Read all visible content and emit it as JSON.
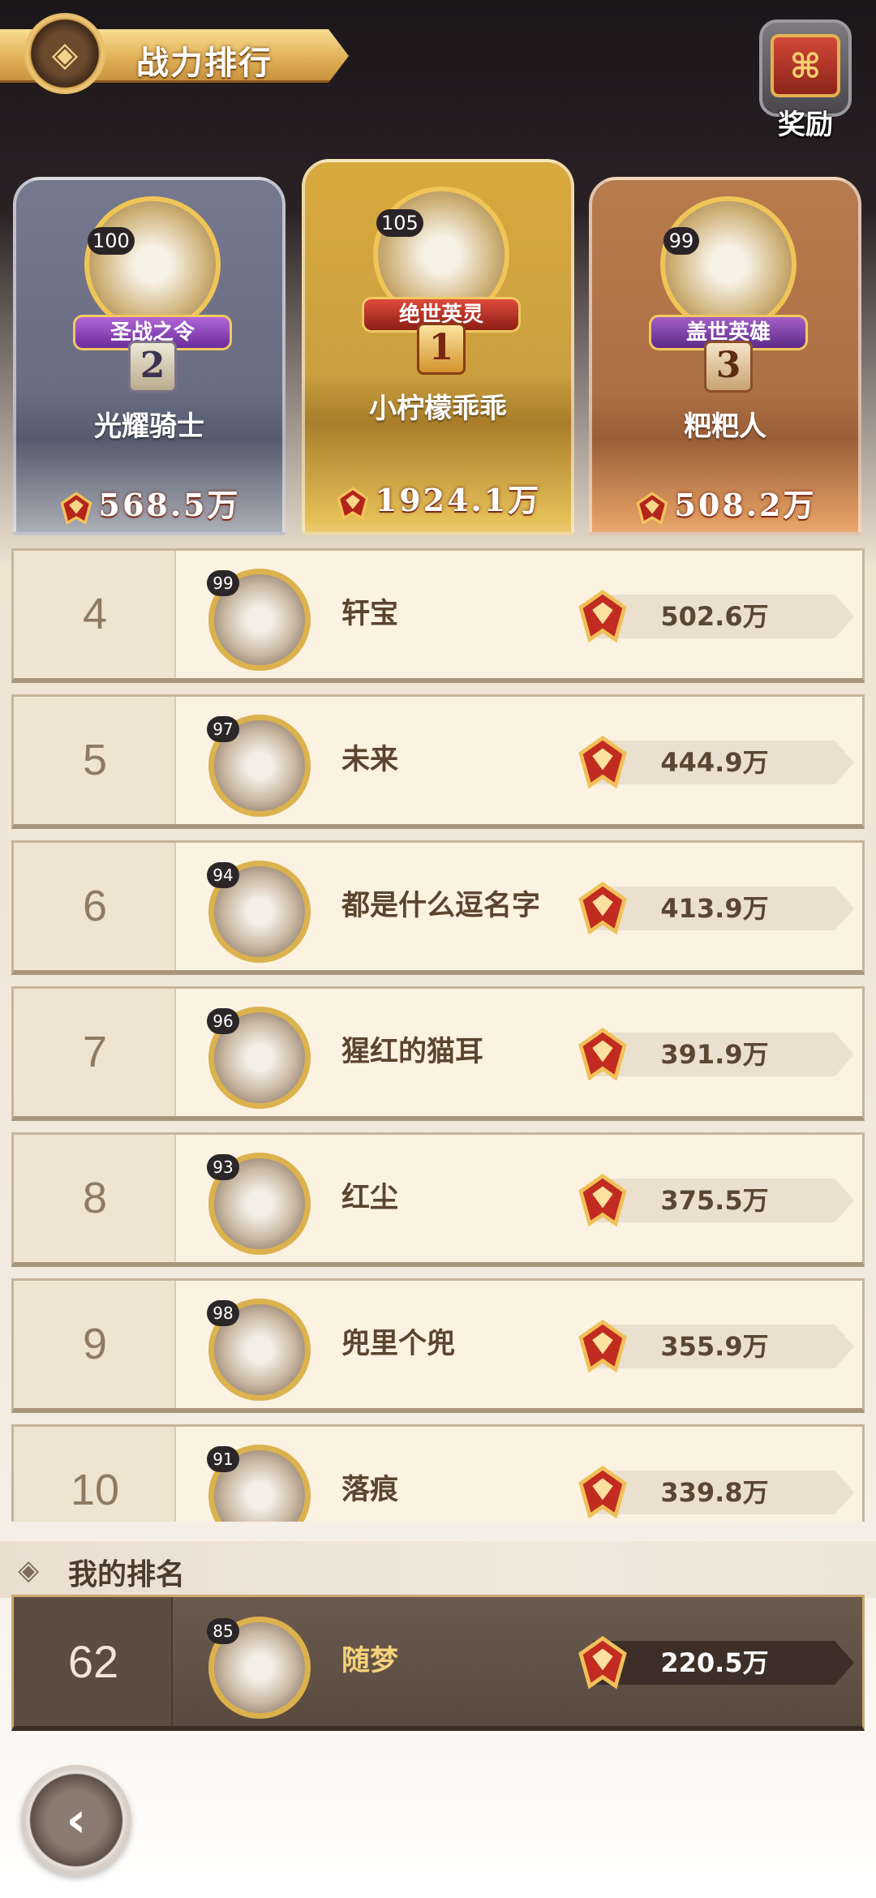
{
  "header": {
    "title": "战力排行",
    "emblem_icon": "shield-emblem-icon",
    "reward_label": "奖励",
    "reward_icon": "treasure-chest-icon"
  },
  "podium": [
    {
      "rank": "2",
      "level": "100",
      "title": "圣战之令",
      "name": "光耀骑士",
      "power": "568.5万"
    },
    {
      "rank": "1",
      "level": "105",
      "title": "绝世英灵",
      "name": "小柠檬乖乖",
      "power": "1924.1万"
    },
    {
      "rank": "3",
      "level": "99",
      "title": "盖世英雄",
      "name": "粑粑人",
      "power": "508.2万"
    }
  ],
  "ranking": [
    {
      "rank": "4",
      "level": "99",
      "name": "轩宝",
      "power": "502.6万"
    },
    {
      "rank": "5",
      "level": "97",
      "name": "未来",
      "power": "444.9万"
    },
    {
      "rank": "6",
      "level": "94",
      "name": "都是什么逗名字",
      "power": "413.9万"
    },
    {
      "rank": "7",
      "level": "96",
      "name": "猩红的猫耳",
      "power": "391.9万"
    },
    {
      "rank": "8",
      "level": "93",
      "name": "红尘",
      "power": "375.5万"
    },
    {
      "rank": "9",
      "level": "98",
      "name": "兜里个兜",
      "power": "355.9万"
    },
    {
      "rank": "10",
      "level": "91",
      "name": "落痕",
      "power": "339.8万"
    }
  ],
  "my_rank": {
    "label": "我的排名",
    "rank": "62",
    "level": "85",
    "name": "随梦",
    "power": "220.5万"
  },
  "back_icon": "back-arrow-icon",
  "colors": {
    "gold": "#e2b258",
    "text_brown": "#5b4430",
    "power_red": "#b3241a"
  }
}
